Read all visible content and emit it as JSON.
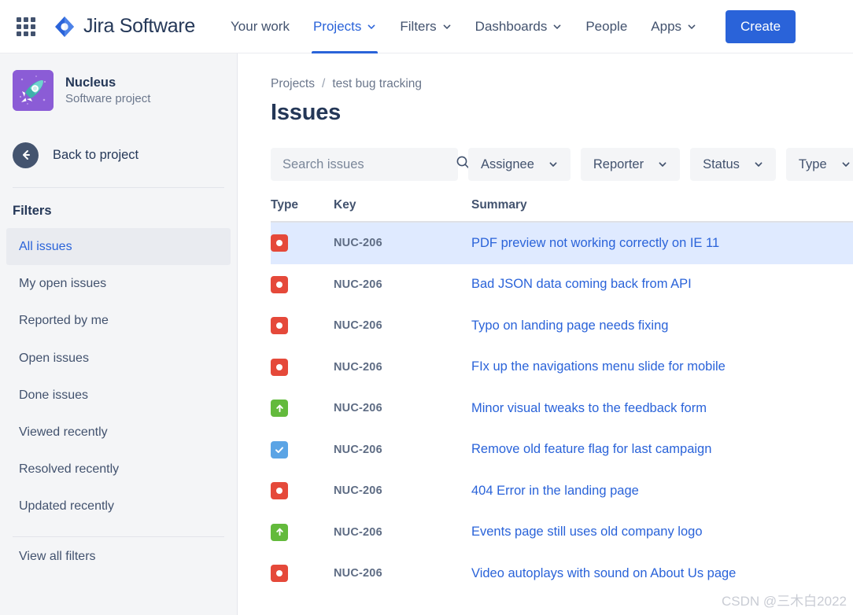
{
  "topnav": {
    "app_switcher_icon": "grid-apps-icon",
    "logo_icon": "jira-diamond-icon",
    "brand": "Jira Software",
    "items": [
      {
        "label": "Your work",
        "has_caret": false,
        "active": false
      },
      {
        "label": "Projects",
        "has_caret": true,
        "active": true
      },
      {
        "label": "Filters",
        "has_caret": true,
        "active": false
      },
      {
        "label": "Dashboards",
        "has_caret": true,
        "active": false
      },
      {
        "label": "People",
        "has_caret": false,
        "active": false
      },
      {
        "label": "Apps",
        "has_caret": true,
        "active": false
      }
    ],
    "create_label": "Create",
    "accent_color": "#2a63d9"
  },
  "sidebar": {
    "project": {
      "avatar_icon": "rocket-icon",
      "avatar_color": "#8b5cd6",
      "name": "Nucleus",
      "type": "Software project"
    },
    "back": {
      "icon": "arrow-left-icon",
      "label": "Back to project"
    },
    "section_title": "Filters",
    "items": [
      {
        "label": "All issues",
        "active": true
      },
      {
        "label": "My open issues",
        "active": false
      },
      {
        "label": "Reported by me",
        "active": false
      },
      {
        "label": "Open issues",
        "active": false
      },
      {
        "label": "Done issues",
        "active": false
      },
      {
        "label": "Viewed recently",
        "active": false
      },
      {
        "label": "Resolved recently",
        "active": false
      },
      {
        "label": "Updated recently",
        "active": false
      }
    ],
    "view_all": "View all filters"
  },
  "main": {
    "breadcrumb": {
      "root": "Projects",
      "separator": "/",
      "current": "test bug tracking"
    },
    "title": "Issues",
    "search": {
      "placeholder": "Search issues",
      "value": "",
      "icon": "search-icon"
    },
    "filters": [
      {
        "label": "Assignee",
        "icon": "chevron-down-icon"
      },
      {
        "label": "Reporter",
        "icon": "chevron-down-icon"
      },
      {
        "label": "Status",
        "icon": "chevron-down-icon"
      },
      {
        "label": "Type",
        "icon": "chevron-down-icon"
      }
    ],
    "table": {
      "columns": [
        "Type",
        "Key",
        "Summary"
      ],
      "rows": [
        {
          "type": "bug",
          "key": "NUC-206",
          "summary": "PDF preview not working correctly on IE 11",
          "selected": true
        },
        {
          "type": "bug",
          "key": "NUC-206",
          "summary": "Bad JSON data coming back from API",
          "selected": false
        },
        {
          "type": "bug",
          "key": "NUC-206",
          "summary": "Typo on landing page needs fixing",
          "selected": false
        },
        {
          "type": "bug",
          "key": "NUC-206",
          "summary": "FIx up the navigations menu slide for mobile",
          "selected": false
        },
        {
          "type": "story",
          "key": "NUC-206",
          "summary": "Minor visual tweaks to the feedback form",
          "selected": false
        },
        {
          "type": "task",
          "key": "NUC-206",
          "summary": "Remove old feature flag for last campaign",
          "selected": false
        },
        {
          "type": "bug",
          "key": "NUC-206",
          "summary": "404 Error in the landing page",
          "selected": false
        },
        {
          "type": "story",
          "key": "NUC-206",
          "summary": "Events page still uses old company logo",
          "selected": false
        },
        {
          "type": "bug",
          "key": "NUC-206",
          "summary": "Video autoplays with sound on About Us page",
          "selected": false
        }
      ],
      "type_colors": {
        "bug": "#e5493a",
        "story": "#63ba3c",
        "task": "#5ba4e5"
      },
      "selected_row_color": "#dfeaff"
    }
  },
  "watermark": "CSDN @三木白2022"
}
